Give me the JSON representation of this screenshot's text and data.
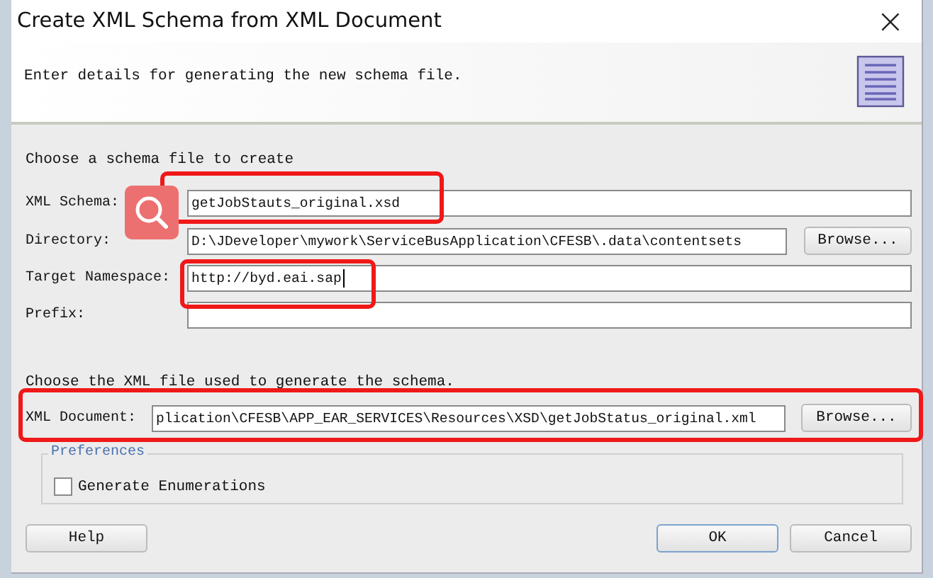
{
  "window": {
    "title": "Create XML Schema from XML Document",
    "close": "×"
  },
  "header": {
    "description": "Enter details for generating the new schema file."
  },
  "schema_section": {
    "heading": "Choose a schema file to create",
    "fields": [
      {
        "label": "XML Schema:",
        "value": "getJobStauts_original.xsd"
      },
      {
        "label": "Directory:",
        "value": "D:\\JDeveloper\\mywork\\ServiceBusApplication\\CFESB\\.data\\contentsets",
        "browse": {
          "label": "Browse..."
        }
      },
      {
        "label": "Target Namespace:",
        "value": "http://byd.eai.sap",
        "focused": true
      },
      {
        "label": "Prefix:"
      }
    ]
  },
  "xml_section": {
    "heading": "Choose the XML file used to generate the schema.",
    "field": {
      "label": "XML Document:",
      "value": "plication\\CFESB\\APP_EAR_SERVICES\\Resources\\XSD\\getJobStatus_original.xml",
      "browse": {
        "label": "Browse..."
      }
    }
  },
  "preferences": {
    "legend": "Preferences",
    "options": [
      {
        "label": "Generate Enumerations",
        "checked": false
      }
    ]
  },
  "buttons": [
    {
      "label": "Help",
      "kind": "help"
    },
    {
      "label": "OK",
      "kind": "default"
    },
    {
      "label": "Cancel",
      "kind": "normal"
    }
  ]
}
